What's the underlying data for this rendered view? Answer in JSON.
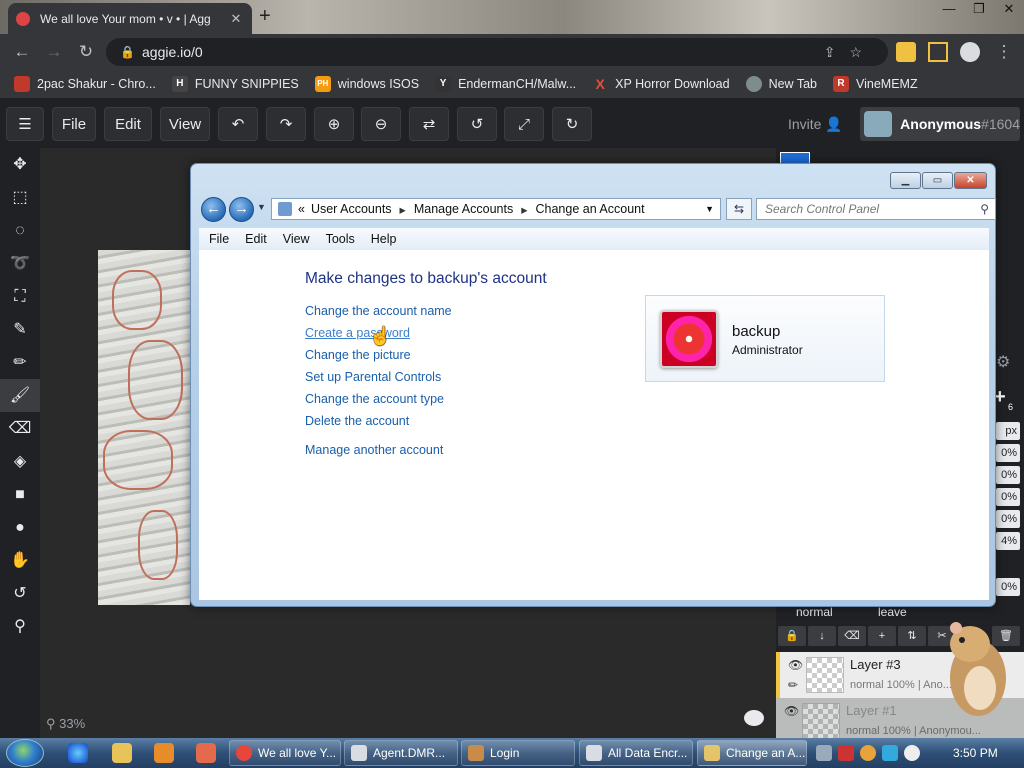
{
  "browser": {
    "tab_title": "We all love Your mom • v • | Agg",
    "tab_close": "✕",
    "new_tab": "+",
    "url": "aggie.io/0",
    "bookmarks": [
      {
        "label": "2pac Shakur - Chro...",
        "icon": "2pac-icon",
        "color": "#c0392b",
        "glyph": ""
      },
      {
        "label": "FUNNY SNIPPIES",
        "icon": "h-icon",
        "color": "#444",
        "glyph": "H"
      },
      {
        "label": "windows ISOS",
        "icon": "ph-icon",
        "color": "#f39c12",
        "glyph": "PH"
      },
      {
        "label": "EndermanCH/Malw...",
        "icon": "yp-icon",
        "color": "#333",
        "glyph": "Y"
      },
      {
        "label": "XP Horror Download",
        "icon": "x-icon",
        "color": "#c0392b",
        "glyph": "X"
      },
      {
        "label": "New Tab",
        "icon": "globe-icon",
        "color": "#7f8c8d",
        "glyph": ""
      },
      {
        "label": "VineMEMZ",
        "icon": "r-icon",
        "color": "#c0392b",
        "glyph": "R"
      }
    ]
  },
  "app": {
    "menu": {
      "file": "File",
      "edit": "Edit",
      "view": "View"
    },
    "invite": "Invite",
    "user": {
      "name": "Anonymous",
      "tag": "#1604"
    },
    "zoom": "33%",
    "size_px": "px",
    "percents": [
      "0%",
      "0%",
      "0%",
      "0%",
      "4%",
      "0%"
    ],
    "blend_mode": "normal",
    "blend_leave": "leave",
    "layers": [
      {
        "name": "Layer #3",
        "sub": "normal  100% | Ano..."
      },
      {
        "name": "Layer #1",
        "sub": "normal  100% | Anonymou..."
      }
    ],
    "badge_6": "6"
  },
  "dialog": {
    "breadcrumb": [
      "User Accounts",
      "Manage Accounts",
      "Change an Account"
    ],
    "breadcrumb_prefix": "«",
    "search_placeholder": "Search Control Panel",
    "menu": [
      "File",
      "Edit",
      "View",
      "Tools",
      "Help"
    ],
    "heading": "Make changes to backup's account",
    "links": [
      "Change the account name",
      "Create a password",
      "Change the picture",
      "Set up Parental Controls",
      "Change the account type",
      "Delete the account"
    ],
    "manage_link": "Manage another account",
    "account": {
      "name": "backup",
      "role": "Administrator"
    }
  },
  "taskbar": {
    "buttons": [
      {
        "label": "We all love Y...",
        "color": "#e8453c"
      },
      {
        "label": "Agent.DMR...",
        "color": "#d8dde3"
      },
      {
        "label": "Login",
        "color": "#c98b4a"
      },
      {
        "label": "All Data Encr...",
        "color": "#d8dde3"
      },
      {
        "label": "Change an A...",
        "color": "#e3c46a"
      }
    ],
    "time": "3:50 PM"
  }
}
